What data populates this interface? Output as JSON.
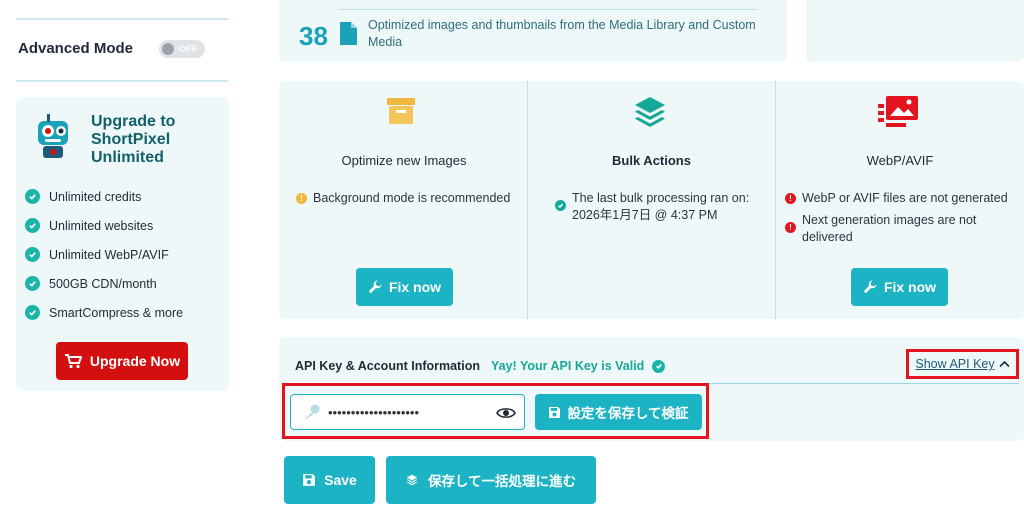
{
  "sidebar": {
    "advanced_mode_label": "Advanced Mode",
    "toggle_state": "OFF",
    "upgrade": {
      "title": "Upgrade to ShortPixel Unlimited",
      "features": [
        "Unlimited credits",
        "Unlimited websites",
        "Unlimited WebP/AVIF",
        "500GB CDN/month",
        "SmartCompress & more"
      ],
      "button_label": "Upgrade Now"
    }
  },
  "stats": {
    "count": "38",
    "description": "Optimized images and thumbnails from the Media Library and Custom Media"
  },
  "cards": [
    {
      "title": "Optimize new Images",
      "icon": "archive-box-icon",
      "status": "Background mode is recommended",
      "status_color": "#f2b63c",
      "button_label": "Fix now"
    },
    {
      "title": "Bulk Actions",
      "icon": "layers-icon",
      "status": "The last bulk processing ran on: 2026年1月7日 @ 4:37 PM",
      "status_color": "#15a896"
    },
    {
      "title": "WebP/AVIF",
      "icon": "images-icon",
      "statuses": [
        "WebP or AVIF files are not generated",
        "Next generation images are not delivered"
      ],
      "status_color": "#e3141f",
      "button_label": "Fix now"
    }
  ],
  "api": {
    "label": "API Key & Account Information",
    "valid_text": "Yay! Your API Key is Valid",
    "show_key_label": "Show API Key",
    "key_masked": "••••••••••••••••••••",
    "save_verify_label": "設定を保存して検証"
  },
  "footer": {
    "save_label": "Save",
    "bulk_label": "保存して一括処理に進む"
  },
  "colors": {
    "accent": "#1cb3c5",
    "card_bg": "#eef8f9",
    "danger": "#d30f10",
    "success": "#15a896"
  }
}
